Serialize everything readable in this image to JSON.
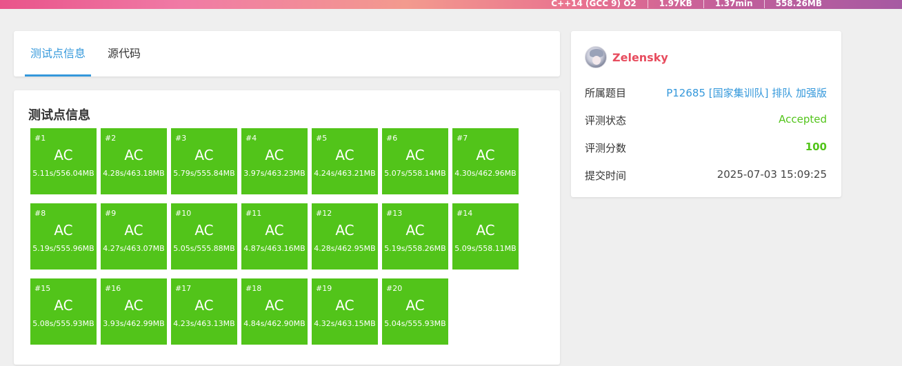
{
  "banner": {
    "items": [
      "C++14 (GCC 9) O2",
      "1.97KB",
      "1.37min",
      "558.26MB"
    ]
  },
  "tabs": [
    {
      "label": "测试点信息",
      "active": true
    },
    {
      "label": "源代码",
      "active": false
    }
  ],
  "tests": {
    "title": "测试点信息",
    "cases": [
      {
        "num": "#1",
        "result": "AC",
        "stat": "5.11s/556.04MB"
      },
      {
        "num": "#2",
        "result": "AC",
        "stat": "4.28s/463.18MB"
      },
      {
        "num": "#3",
        "result": "AC",
        "stat": "5.79s/555.84MB"
      },
      {
        "num": "#4",
        "result": "AC",
        "stat": "3.97s/463.23MB"
      },
      {
        "num": "#5",
        "result": "AC",
        "stat": "4.24s/463.21MB"
      },
      {
        "num": "#6",
        "result": "AC",
        "stat": "5.07s/558.14MB"
      },
      {
        "num": "#7",
        "result": "AC",
        "stat": "4.30s/462.96MB"
      },
      {
        "num": "#8",
        "result": "AC",
        "stat": "5.19s/555.96MB"
      },
      {
        "num": "#9",
        "result": "AC",
        "stat": "4.27s/463.07MB"
      },
      {
        "num": "#10",
        "result": "AC",
        "stat": "5.05s/555.88MB"
      },
      {
        "num": "#11",
        "result": "AC",
        "stat": "4.87s/463.16MB"
      },
      {
        "num": "#12",
        "result": "AC",
        "stat": "4.28s/462.95MB"
      },
      {
        "num": "#13",
        "result": "AC",
        "stat": "5.19s/558.26MB"
      },
      {
        "num": "#14",
        "result": "AC",
        "stat": "5.09s/558.11MB"
      },
      {
        "num": "#15",
        "result": "AC",
        "stat": "5.08s/555.93MB"
      },
      {
        "num": "#16",
        "result": "AC",
        "stat": "3.93s/462.99MB"
      },
      {
        "num": "#17",
        "result": "AC",
        "stat": "4.23s/463.13MB"
      },
      {
        "num": "#18",
        "result": "AC",
        "stat": "4.84s/462.90MB"
      },
      {
        "num": "#19",
        "result": "AC",
        "stat": "4.32s/463.15MB"
      },
      {
        "num": "#20",
        "result": "AC",
        "stat": "5.04s/555.93MB"
      }
    ]
  },
  "info": {
    "user": "Zelensky",
    "problem_label": "所属题目",
    "problem_value": "P12685 [国家集训队] 排队 加强版",
    "status_label": "评测状态",
    "status_value": "Accepted",
    "score_label": "评测分数",
    "score_value": "100",
    "time_label": "提交时间",
    "time_value": "2025-07-03 15:09:25"
  },
  "colors": {
    "accepted": "#52c41a",
    "link": "#3498db",
    "username": "#e74c5e"
  }
}
